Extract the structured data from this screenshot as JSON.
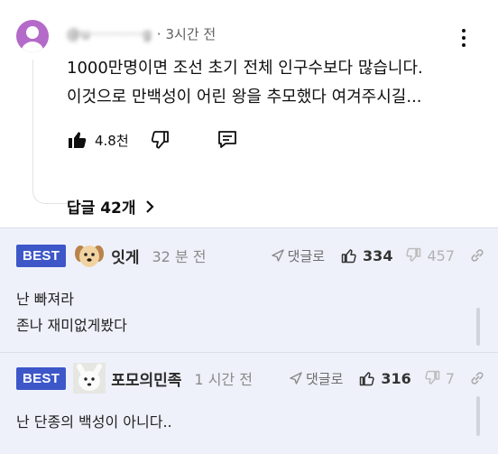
{
  "youtube_comment": {
    "handle": "@u··········g",
    "separator": "·",
    "time": "3시간 전",
    "text_line1": "1000만명이면 조선 초기 전체 인구수보다 많습니다.",
    "text_line2": "이것으로 만백성이  어린 왕을 추모했다 여겨주시길...",
    "like_count": "4.8천",
    "replies_label": "답글 42개",
    "avatar_color": "#b46ac9",
    "icons": [
      "like-icon",
      "dislike-icon",
      "reply-icon",
      "more-vert-icon",
      "chevron-right-icon"
    ]
  },
  "board": {
    "accent_color": "#3d57c8",
    "comments": [
      {
        "badge": "BEST",
        "nickname": "잇게",
        "time": "32 분 전",
        "reply_label": "댓글로",
        "upvotes": "334",
        "downvotes": "457",
        "lines": [
          "난 빠져라",
          "존나 재미없게봤다"
        ],
        "avatar": "puppy"
      },
      {
        "badge": "BEST",
        "nickname": "포모의민족",
        "time": "1 시간 전",
        "reply_label": "댓글로",
        "upvotes": "316",
        "downvotes": "7",
        "lines": [
          "난 단종의 백성이 아니다.."
        ],
        "avatar": "white-dog"
      }
    ]
  }
}
